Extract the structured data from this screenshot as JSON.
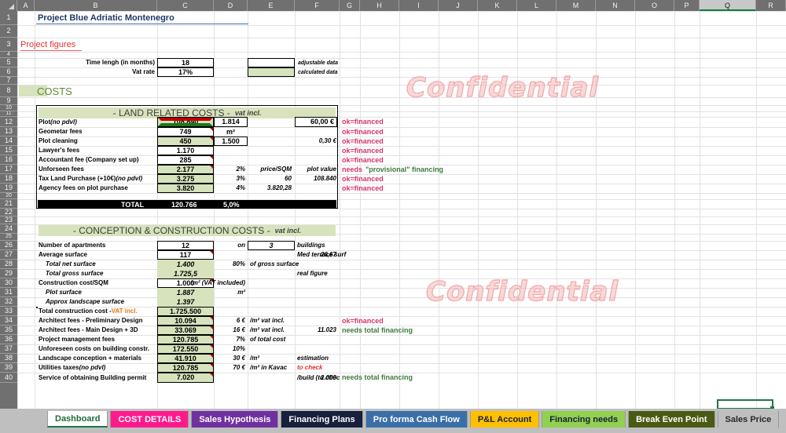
{
  "sheet": {
    "columns": [
      "A",
      "B",
      "C",
      "D",
      "E",
      "F",
      "G",
      "H",
      "I",
      "J",
      "K",
      "L",
      "M",
      "N",
      "O",
      "P",
      "Q",
      "R"
    ],
    "selected_column": "Q",
    "selected_cell": "Q40",
    "rows": [
      1,
      2,
      3,
      4,
      5,
      6,
      7,
      8,
      9,
      10,
      11,
      12,
      13,
      14,
      15,
      16,
      17,
      18,
      19,
      20,
      21,
      22,
      23,
      24,
      25,
      26,
      27,
      28,
      29,
      30,
      31,
      32,
      33,
      34,
      35,
      36,
      37,
      38,
      39,
      40
    ]
  },
  "watermark": {
    "text": "Confidential",
    "color": "#f0a7a7"
  },
  "header": {
    "project_title": "Project Blue Adriatic Montenegro",
    "project_figures": "Project figures",
    "costs_heading": "COSTS"
  },
  "figures": {
    "time_length_label": "Time lengh (in months)",
    "time_length_value": "18",
    "vat_rate_label": "Vat rate",
    "vat_rate_value": "17%",
    "legend_adjustable": "adjustable data",
    "legend_calculated": "calculated data"
  },
  "land": {
    "section_title": "- LAND RELATED COSTS -",
    "section_sub": "vat incl.",
    "rows": [
      {
        "label": "Plot",
        "note": "(no pdvl)",
        "c": "108.840",
        "d": "1.814",
        "e": "",
        "f": "60,00 €",
        "g": "ok=financed",
        "g2": "",
        "fill": "green",
        "dbox": true,
        "fbox": true
      },
      {
        "label": "Geometar fees",
        "note": "",
        "c": "749",
        "d": "m²",
        "e": "",
        "f": "",
        "g": "ok=financed",
        "g2": "",
        "fill": "white",
        "dbox": false,
        "fbox": false
      },
      {
        "label": "Plot cleaning",
        "note": "",
        "c": "450",
        "d": "1.500",
        "e": "",
        "f": "0,30 €",
        "g": "ok=financed",
        "g2": "",
        "fill": "green",
        "dbox": true,
        "fbox": false
      },
      {
        "label": "Lawyer's fees",
        "note": "",
        "c": "1.170",
        "d": "",
        "e": "",
        "f": "",
        "g": "ok=financed",
        "g2": "",
        "fill": "white",
        "dbox": false,
        "fbox": false
      },
      {
        "label": "Accountant fee (Company set up)",
        "note": "",
        "c": "285",
        "d": "",
        "e": "",
        "f": "",
        "g": "ok=financed",
        "g2": "",
        "fill": "white",
        "dbox": false,
        "fbox": false
      },
      {
        "label": "Unforseen fees",
        "note": "",
        "c": "2.177",
        "d": "2%",
        "e": "price/SQM",
        "f": "plot value",
        "g": "needs",
        "g2": "\"provisional\" financing",
        "fill": "green",
        "dbox": false,
        "fbox": false
      },
      {
        "label": "Tax Land Purchase (+10€)",
        "note": "(no pdvl)",
        "c": "3.275",
        "d": "3%",
        "e": "60",
        "f": "108.840",
        "g": "ok=financed",
        "g2": "",
        "fill": "green",
        "dbox": false,
        "fbox": false
      },
      {
        "label": "Agency fees on plot purchase",
        "note": "",
        "c": "3.820",
        "d": "4%",
        "e": "3.820,28",
        "f": "",
        "g": "ok=financed",
        "g2": "",
        "fill": "green",
        "dbox": false,
        "fbox": false
      }
    ],
    "total_label": "TOTAL",
    "total_value": "120.766",
    "total_pct": "5,0%"
  },
  "construction": {
    "section_title": "- CONCEPTION & CONSTRUCTION COSTS -",
    "section_sub": "vat incl.",
    "rows": [
      {
        "label": "Number of apartments",
        "indent": false,
        "c": "12",
        "d": "on",
        "e": "3",
        "f": "buildings",
        "g": "",
        "g2": "",
        "style": "boxwhite"
      },
      {
        "label": "Average surface",
        "indent": false,
        "c": "117",
        "d": "",
        "e": "26,67",
        "f": "Med terrace surf",
        "g": "",
        "g2": "",
        "style": "boxwhite"
      },
      {
        "label": "Total net surface",
        "indent": true,
        "c": "1.400",
        "d": "80%",
        "e": "of gross surface",
        "f": "",
        "g": "",
        "g2": "",
        "style": "greenplain"
      },
      {
        "label": "Total gross surface",
        "indent": true,
        "c": "1.725,5",
        "d": "",
        "e": "",
        "f": "real figure",
        "g": "",
        "g2": "",
        "style": "greenplain"
      },
      {
        "label": "Construction cost/SQM",
        "indent": false,
        "c": "1.000",
        "d": "/m² (VAT included)",
        "e": "",
        "f": "",
        "g": "",
        "g2": "",
        "style": "boxwhite"
      },
      {
        "label": "Plot surface",
        "indent": true,
        "c": "1.887",
        "d": "m²",
        "e": "",
        "f": "",
        "g": "",
        "g2": "",
        "style": "greenplain"
      },
      {
        "label": "Approx landscape surface",
        "indent": true,
        "c": "1.397",
        "d": "",
        "e": "",
        "f": "",
        "g": "",
        "g2": "",
        "style": "greenplain"
      },
      {
        "label": "Total construction cost -",
        "labelsuffix": "VAT incl.",
        "indent": false,
        "c": "1.725.500",
        "d": "",
        "e": "",
        "f": "",
        "g": "",
        "g2": "",
        "style": "greenbox"
      },
      {
        "label": "Architect fees - Preliminary Design",
        "indent": false,
        "c": "10.094",
        "d": "6 €",
        "e": "/m² vat incl.",
        "f": "",
        "g": "ok=financed",
        "g2": "",
        "style": "greenbox"
      },
      {
        "label": "Architect fees - Main Design + 3D",
        "indent": false,
        "c": "33.069",
        "d": "16 €",
        "e": "/m² vat incl.",
        "f": "11.023",
        "g": "",
        "g2": "needs total financing",
        "style": "greenbox"
      },
      {
        "label": "Project management fees",
        "indent": false,
        "c": "120.785",
        "d": "7%",
        "e": "of total cost",
        "f": "",
        "g": "",
        "g2": "",
        "style": "greenbox"
      },
      {
        "label": "Unforeseen costs on building constr.",
        "indent": false,
        "c": "172.550",
        "d": "10%",
        "e": "",
        "f": "",
        "g": "",
        "g2": "",
        "style": "greenbox"
      },
      {
        "label": "Landscape conception + materials",
        "indent": false,
        "c": "41.910",
        "d": "30 €",
        "e": "/m²",
        "f": "estimation",
        "g": "",
        "g2": "",
        "style": "greenbox"
      },
      {
        "label": "Utilities taxes",
        "note": "(no pdvl)",
        "indent": false,
        "c": "120.785",
        "d": "70 €",
        "e": "/m² in Kavac",
        "f": "to check",
        "g": "",
        "g2": "",
        "style": "greenbox"
      },
      {
        "label": "Service of obtaining Building permit",
        "indent": false,
        "c": "7.020",
        "d": "",
        "e": "2.000",
        "f": "/build (to chec",
        "g": "",
        "g2": "needs total financing",
        "style": "greenbox"
      }
    ]
  },
  "tabs": [
    {
      "label": "Dashboard",
      "bg": "#ffffff",
      "fg": "#1f6b3a",
      "active": true
    },
    {
      "label": "COST DETAILS",
      "bg": "#ff1a8c",
      "fg": "#ffffff",
      "active": false
    },
    {
      "label": "Sales Hypothesis",
      "bg": "#7030a0",
      "fg": "#ffffff",
      "active": false
    },
    {
      "label": "Financing Plans",
      "bg": "#17203c",
      "fg": "#ffffff",
      "active": false
    },
    {
      "label": "Pro forma Cash Flow",
      "bg": "#3a6fa8",
      "fg": "#ffffff",
      "active": false
    },
    {
      "label": "P&L Account",
      "bg": "#ffc000",
      "fg": "#17203c",
      "active": false
    },
    {
      "label": "Financing needs",
      "bg": "#92d050",
      "fg": "#17203c",
      "active": false
    },
    {
      "label": "Break Even Point",
      "bg": "#4a5a15",
      "fg": "#ffffff",
      "active": false
    },
    {
      "label": "Sales Price",
      "bg": "#bfbfbf",
      "fg": "#2a2a2a",
      "active": false
    }
  ],
  "colors": {
    "accent_green": "#217346",
    "fill_green": "#d6e3bc",
    "ok_text": "#d6336c",
    "needs_text": "#3f7a3f",
    "title_blue": "#1f3864",
    "red_heading": "#e03131",
    "orange": "#e8770d"
  }
}
